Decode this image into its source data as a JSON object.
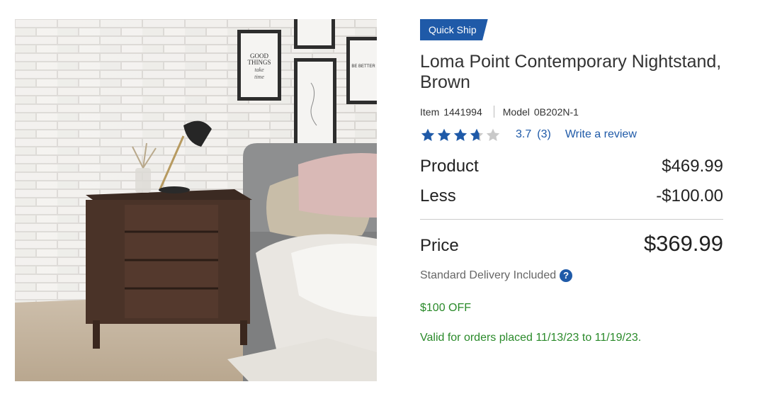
{
  "product_image": {
    "alt": "Loma Point Contemporary Nightstand in bedroom scene"
  },
  "badge": {
    "label": "Quick Ship",
    "color": "#1f5aa8"
  },
  "title": "Loma Point Contemporary Nightstand, Brown",
  "meta": {
    "item_label": "Item",
    "item_number": "1441994",
    "model_label": "Model",
    "model_number": "0B202N-1"
  },
  "rating": {
    "stars": 3.7,
    "value_text": "3.7",
    "count_text": "(3)",
    "write_review": "Write a review",
    "star_color": "#1f5aa8"
  },
  "pricing": {
    "product_label": "Product",
    "product_amount": "$469.99",
    "less_label": "Less",
    "less_amount": "-$100.00",
    "price_label": "Price",
    "price_amount": "$369.99"
  },
  "delivery": {
    "text": "Standard Delivery Included",
    "help_icon": "question-circle-icon"
  },
  "promo": {
    "offer": "$100 OFF",
    "validity": "Valid for orders placed 11/13/23 to 11/19/23.",
    "color": "#2a8a2a"
  }
}
